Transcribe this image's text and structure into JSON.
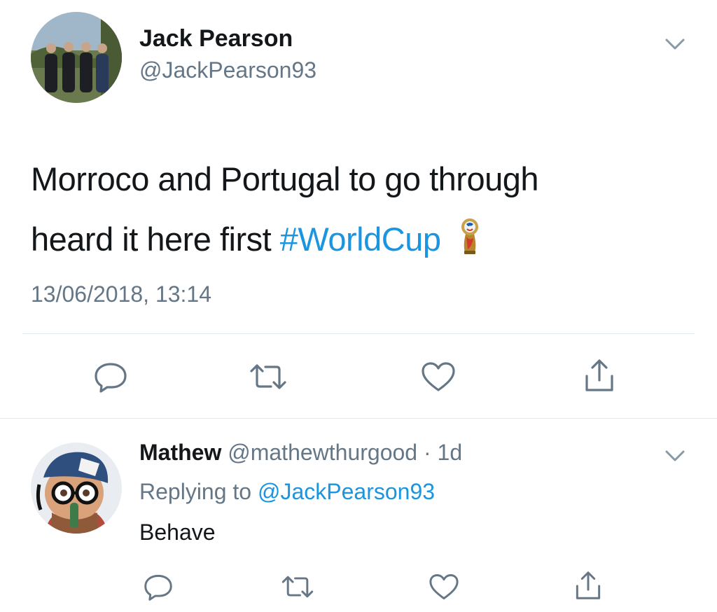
{
  "tweet": {
    "author_name": "Jack Pearson",
    "author_handle": "@JackPearson93",
    "text_part1": "Morroco and Portugal to go through",
    "text_part2": "heard it here first",
    "hashtag": "#WorldCup",
    "timestamp": "13/06/2018, 13:14"
  },
  "reply": {
    "author_name": "Mathew",
    "author_handle": "@mathewthurgood",
    "separator": "·",
    "age": "1d",
    "replying_prefix": "Replying to",
    "replying_handle": "@JackPearson93",
    "text": "Behave"
  },
  "icons": {
    "reply": "reply-icon",
    "retweet": "retweet-icon",
    "like": "heart-icon",
    "share": "share-icon",
    "menu": "chevron-down-icon",
    "trophy": "world-cup-trophy-icon"
  },
  "colors": {
    "link": "#1b95e0",
    "muted": "#657786",
    "icon": "#657786",
    "divider": "#e1e8ed"
  }
}
